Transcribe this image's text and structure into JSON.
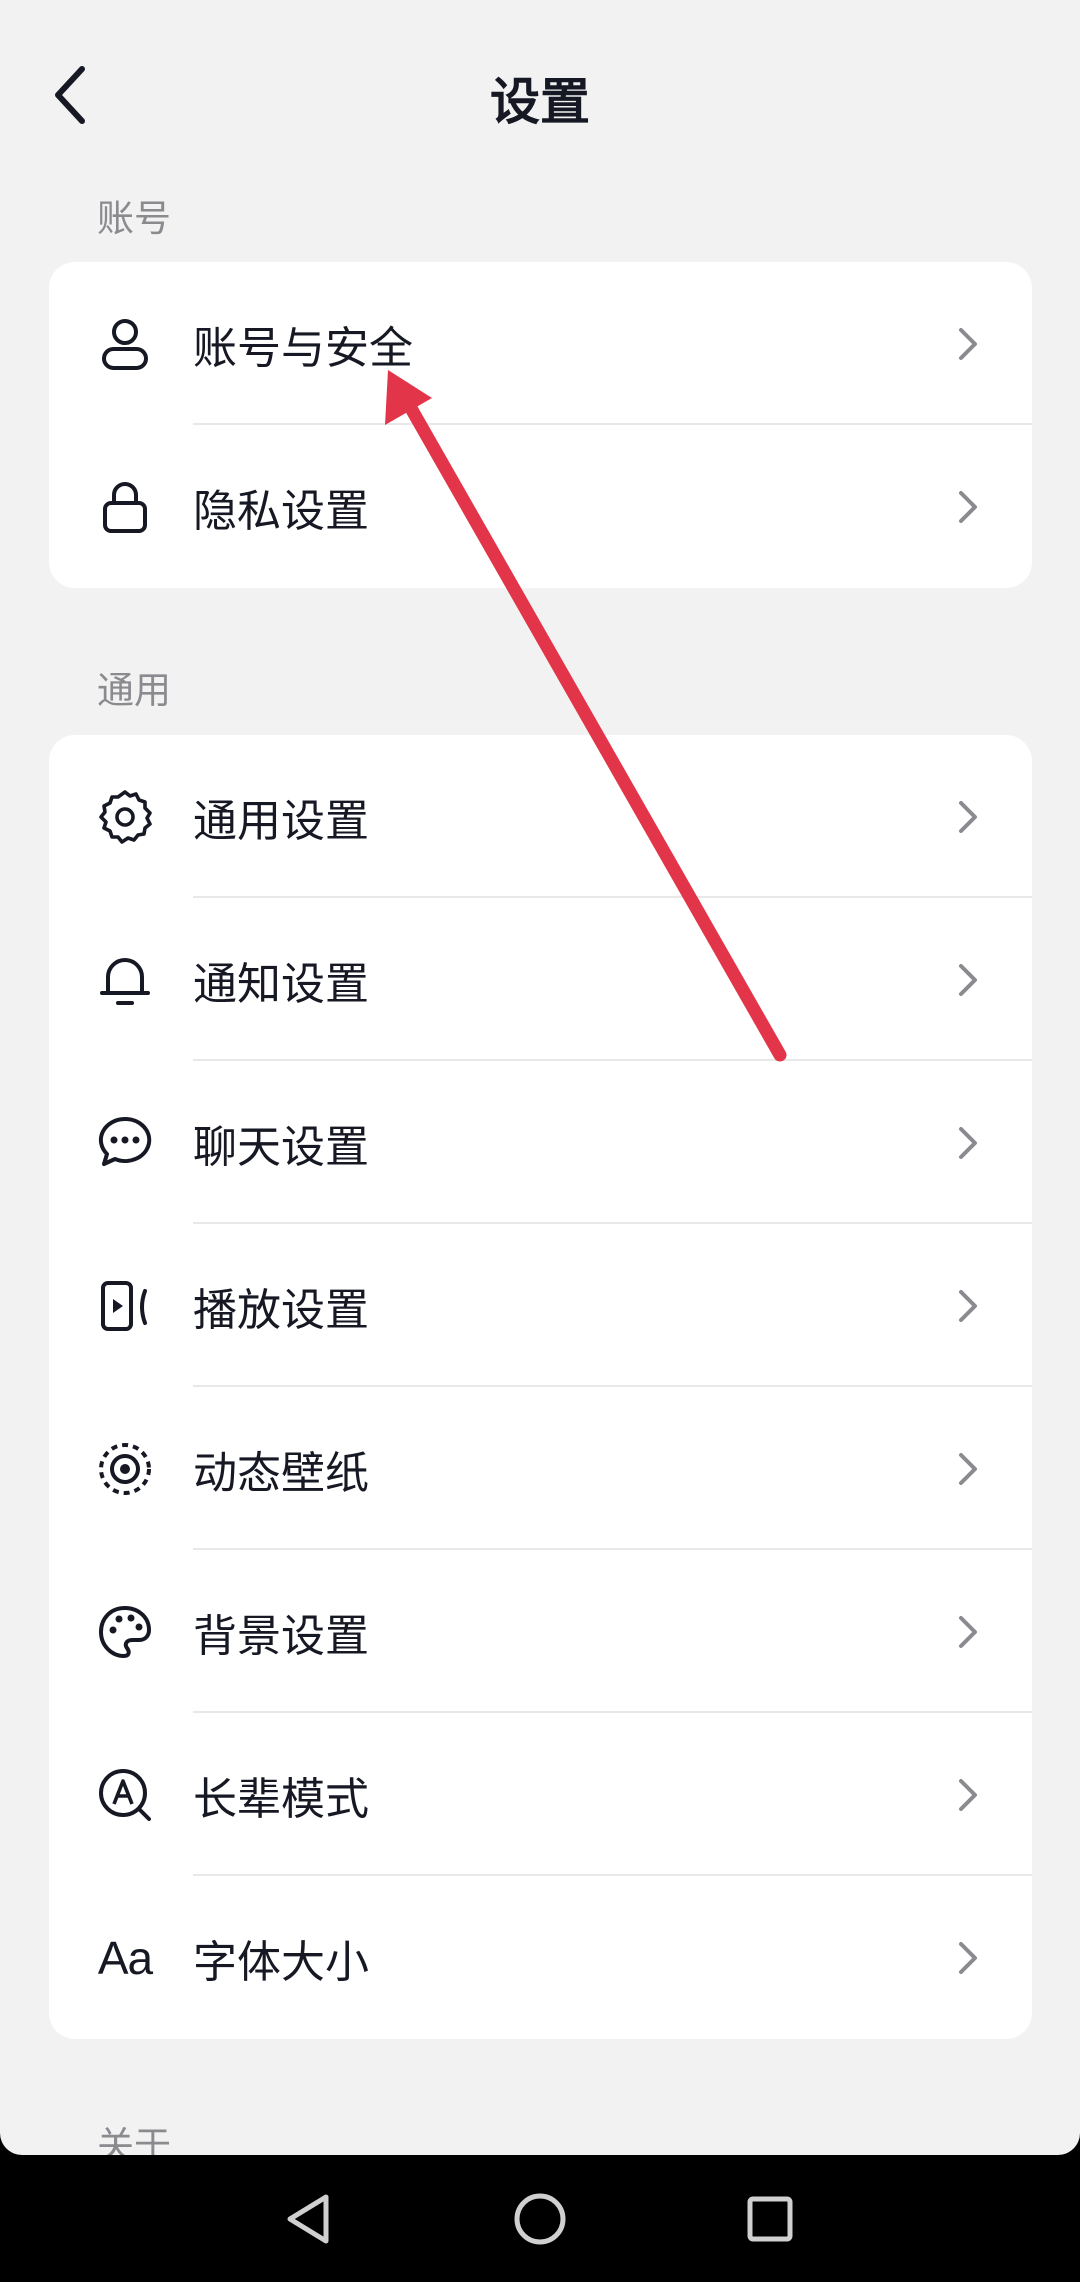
{
  "header": {
    "title": "设置"
  },
  "sections": [
    {
      "label": "账号",
      "items": [
        {
          "label": "账号与安全"
        },
        {
          "label": "隐私设置"
        }
      ]
    },
    {
      "label": "通用",
      "items": [
        {
          "label": "通用设置"
        },
        {
          "label": "通知设置"
        },
        {
          "label": "聊天设置"
        },
        {
          "label": "播放设置"
        },
        {
          "label": "动态壁纸"
        },
        {
          "label": "背景设置"
        },
        {
          "label": "长辈模式"
        },
        {
          "label": "字体大小",
          "icon_text": "Aa"
        }
      ]
    },
    {
      "label": "关于"
    }
  ],
  "icons": {
    "back": "chevron-left-icon",
    "account": "user-icon",
    "privacy": "lock-icon",
    "general": "gear-icon",
    "notify": "bell-icon",
    "chat": "chat-bubble-icon",
    "playback": "playback-icon",
    "wallpaper": "target-icon",
    "background": "palette-icon",
    "elder": "elder-mode-icon",
    "font": "font-size-icon"
  },
  "colors": {
    "background": "#f2f2f2",
    "card": "#ffffff",
    "text": "#161823",
    "muted": "#8a8a8f",
    "annotation_arrow": "#e3354a"
  }
}
